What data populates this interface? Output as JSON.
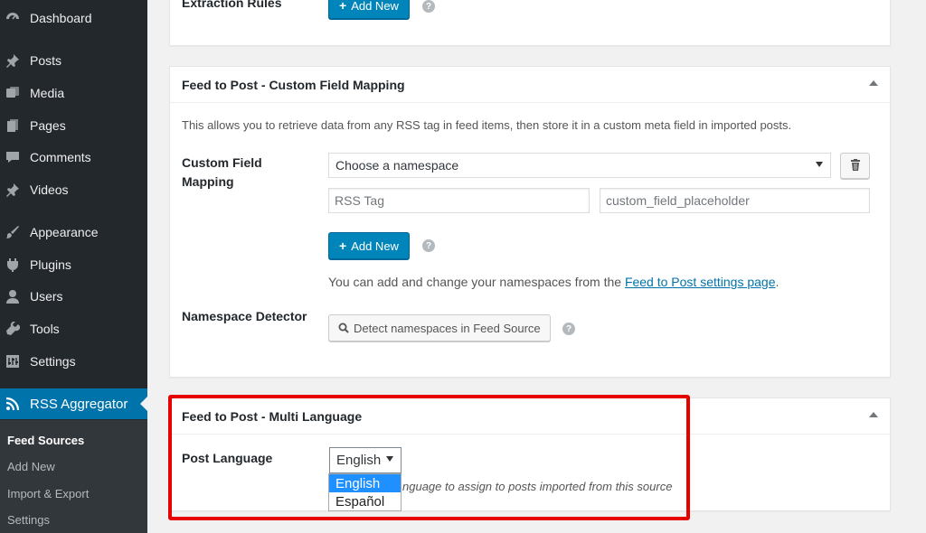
{
  "sidebar": {
    "items": [
      {
        "label": "Dashboard",
        "icon": "dashboard-icon"
      },
      {
        "label": "Posts",
        "icon": "pin-icon"
      },
      {
        "label": "Media",
        "icon": "media-icon"
      },
      {
        "label": "Pages",
        "icon": "pages-icon"
      },
      {
        "label": "Comments",
        "icon": "comment-icon"
      },
      {
        "label": "Videos",
        "icon": "pin-icon"
      },
      {
        "label": "Appearance",
        "icon": "brush-icon"
      },
      {
        "label": "Plugins",
        "icon": "plugin-icon"
      },
      {
        "label": "Users",
        "icon": "user-icon"
      },
      {
        "label": "Tools",
        "icon": "wrench-icon"
      },
      {
        "label": "Settings",
        "icon": "settings-icon"
      },
      {
        "label": "RSS Aggregator",
        "icon": "rss-icon"
      }
    ],
    "submenu": [
      "Feed Sources",
      "Add New",
      "Import & Export",
      "Settings"
    ]
  },
  "extraction": {
    "label": "Extraction Rules",
    "add_new": "Add New"
  },
  "custom_field_panel": {
    "title": "Feed to Post - Custom Field Mapping",
    "description": "This allows you to retrieve data from any RSS tag in feed items, then store it in a custom meta field in imported posts.",
    "mapping_label_line1": "Custom Field",
    "mapping_label_line2": "Mapping",
    "namespace_select": "Choose a namespace",
    "rss_tag_placeholder": "RSS Tag",
    "custom_field_placeholder": "custom_field_placeholder",
    "add_new": "Add New",
    "namespace_note_prefix": "You can add and change your namespaces from the ",
    "namespace_note_link": "Feed to Post settings page",
    "namespace_note_suffix": ".",
    "detector_label": "Namespace Detector",
    "detect_button": "Detect namespaces in Feed Source"
  },
  "multi_language_panel": {
    "title": "Feed to Post - Multi Language",
    "post_language_label": "Post Language",
    "selected_language": "English",
    "options": [
      "English",
      "Español"
    ],
    "description_partial": "nguage to assign to posts imported from this source"
  },
  "colors": {
    "sidebar_bg": "#23282d",
    "active_menu": "#0073aa",
    "primary_button": "#0085ba",
    "highlight_border": "#e60000"
  }
}
